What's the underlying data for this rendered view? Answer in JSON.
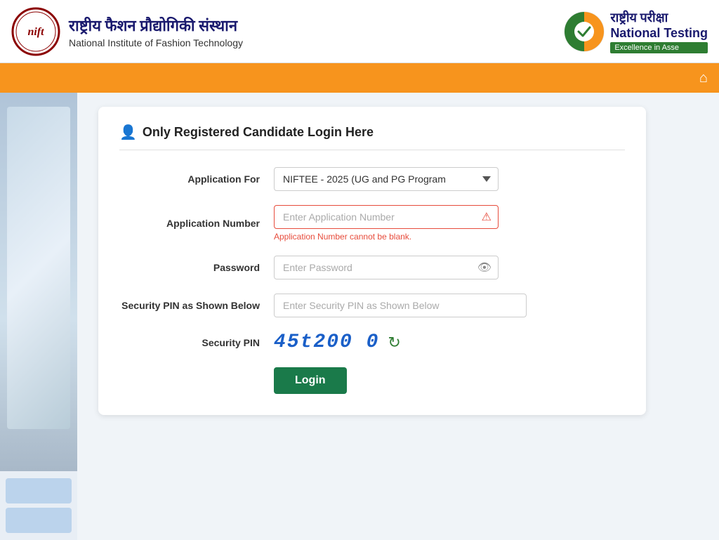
{
  "header": {
    "nift_hindi": "राष्ट्रीय फैशन प्रौद्योगिकी संस्थान",
    "nift_english": "National Institute of Fashion Technology",
    "nta_hindi": "राष्ट्रीय परीक्षा",
    "nta_english": "National Testing",
    "nta_tagline": "Excellence in Asse"
  },
  "nav": {
    "home_icon": "⌂"
  },
  "login_section": {
    "title": "Only Registered Candidate Login Here",
    "fields": {
      "application_for_label": "Application For",
      "application_for_value": "NIFTEE - 2025 (UG and PG Program",
      "application_number_label": "Application Number",
      "application_number_placeholder": "Enter Application Number",
      "application_number_error": "Application Number cannot be blank.",
      "password_label": "Password",
      "password_placeholder": "Enter Password",
      "security_pin_input_label": "Security PIN as Shown Below",
      "security_pin_input_placeholder": "Enter Security PIN as Shown Below",
      "security_pin_label": "Security PIN",
      "security_pin_value": "45t200 0",
      "login_button": "Login"
    }
  }
}
